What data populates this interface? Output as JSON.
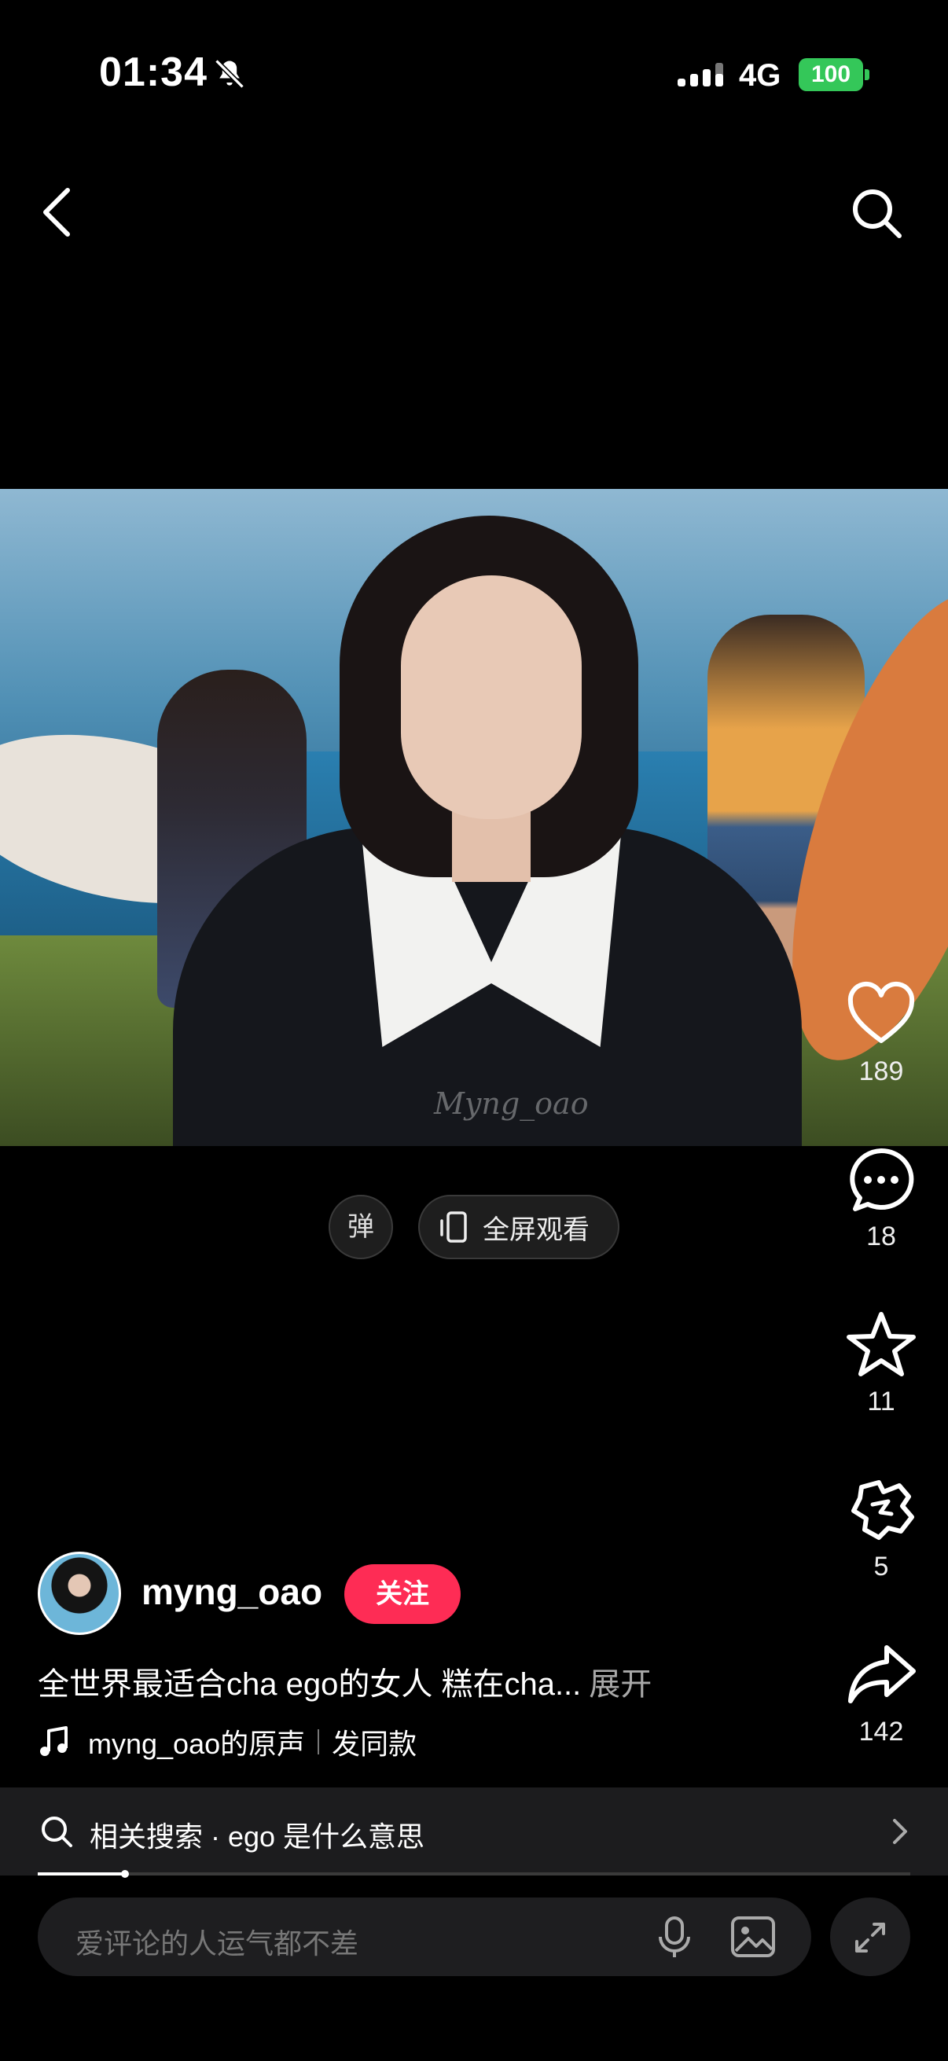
{
  "status_bar": {
    "time": "01:34",
    "network": "4G",
    "battery": "100",
    "battery_color": "#34c759"
  },
  "nav": {
    "back_icon": "chevron-left-icon",
    "search_icon": "search-icon"
  },
  "video": {
    "watermark": "Myng_oao"
  },
  "controls": {
    "danmu_label": "弹",
    "fullscreen_label": "全屏观看"
  },
  "actions": {
    "likes": "189",
    "comments": "18",
    "favorites": "11",
    "shares_inner": "5",
    "shares": "142"
  },
  "author": {
    "username": "myng_oao",
    "follow_label": "关注",
    "follow_color": "#fe2c55"
  },
  "caption": {
    "text": "全世界最适合cha ego的女人 糕在cha...",
    "expand": "展开"
  },
  "music": {
    "source": "myng_oao的原声",
    "use_same": "发同款"
  },
  "related": {
    "text": "相关搜索 · ego 是什么意思"
  },
  "progress": {
    "fraction": 0.1
  },
  "comment": {
    "placeholder": "爱评论的人运气都不差"
  }
}
